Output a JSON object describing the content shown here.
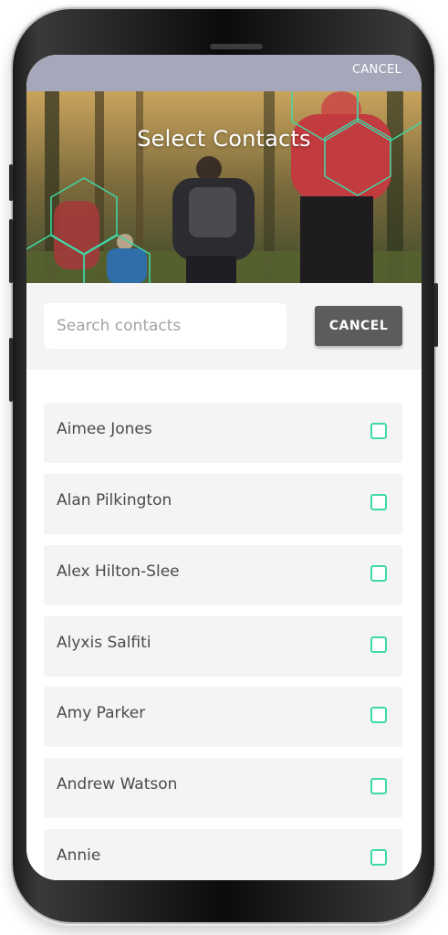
{
  "header": {
    "cancel_label": "CANCEL",
    "title": "Select Contacts"
  },
  "search": {
    "placeholder": "Search contacts",
    "value": "",
    "cancel_label": "CANCEL"
  },
  "contacts": [
    {
      "name": "Aimee Jones",
      "checked": false
    },
    {
      "name": "Alan Pilkington",
      "checked": false
    },
    {
      "name": "Alex Hilton-Slee",
      "checked": false
    },
    {
      "name": "Alyxis Salfiti",
      "checked": false
    },
    {
      "name": "Amy Parker",
      "checked": false
    },
    {
      "name": "Andrew Watson",
      "checked": false
    },
    {
      "name": "Annie",
      "checked": false
    }
  ],
  "colors": {
    "accent": "#3fd9a6",
    "topbar": "#a7a7bb",
    "button": "#5c5c5c",
    "row_bg": "#f4f4f5"
  },
  "icons": {
    "checkbox": "checkbox-icon",
    "hexagon_pattern": "hexagon-pattern-icon"
  }
}
